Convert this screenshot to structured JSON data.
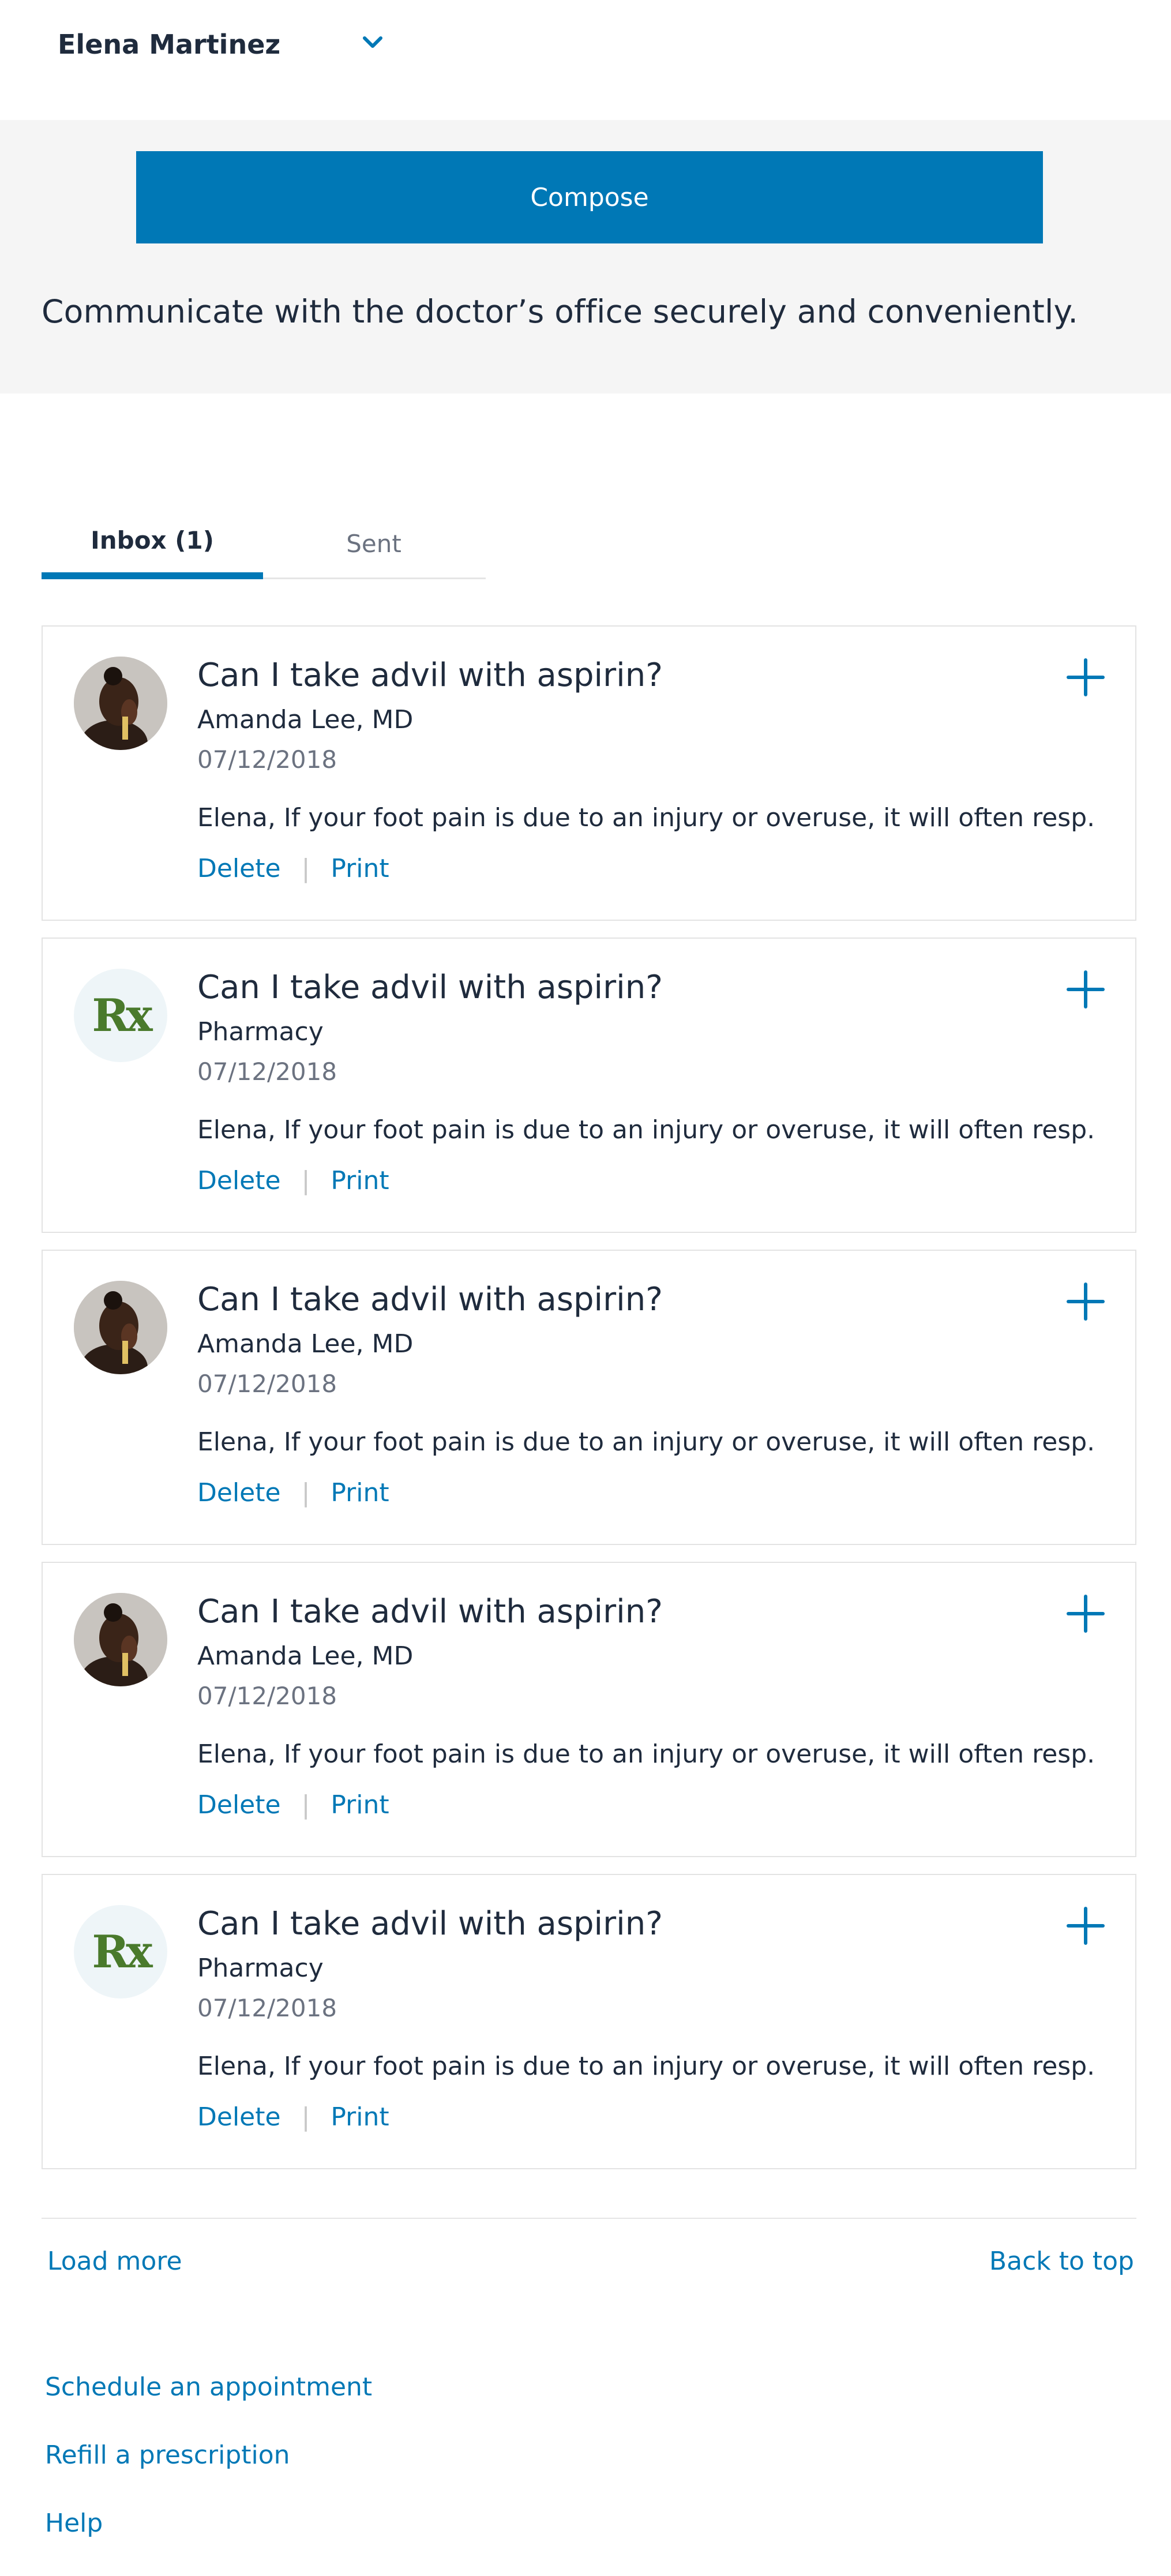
{
  "user": {
    "name": "Elena Martinez",
    "chevron_icon": "chevron-down-icon"
  },
  "hero": {
    "compose_label": "Compose",
    "description": "Communicate with the doctor’s office securely and conveniently."
  },
  "tabs": [
    {
      "label": "Inbox (1)",
      "active": true
    },
    {
      "label": "Sent",
      "active": false
    }
  ],
  "messages": [
    {
      "title": "Can I take advil with aspirin?",
      "sender": "Amanda Lee, MD",
      "date": "07/12/2018",
      "preview": "Elena, If your foot pain is due to an injury or overuse, it will often resp...",
      "avatar": "doctor-photo",
      "delete_label": "Delete",
      "print_label": "Print"
    },
    {
      "title": "Can I take advil with aspirin?",
      "sender": "Pharmacy",
      "date": "07/12/2018",
      "preview": "Elena, If your foot pain is due to an injury or overuse, it will often resp...",
      "avatar": "rx",
      "avatar_text": "Rx",
      "delete_label": "Delete",
      "print_label": "Print"
    },
    {
      "title": "Can I take advil with aspirin?",
      "sender": "Amanda Lee, MD",
      "date": "07/12/2018",
      "preview": "Elena, If your foot pain is due to an injury or overuse, it will often resp...",
      "avatar": "doctor-photo",
      "delete_label": "Delete",
      "print_label": "Print"
    },
    {
      "title": "Can I take advil with aspirin?",
      "sender": "Amanda Lee, MD",
      "date": "07/12/2018",
      "preview": "Elena, If your foot pain is due to an injury or overuse, it will often resp...",
      "avatar": "doctor-photo",
      "delete_label": "Delete",
      "print_label": "Print"
    },
    {
      "title": "Can I take advil with aspirin?",
      "sender": "Pharmacy",
      "date": "07/12/2018",
      "preview": "Elena, If your foot pain is due to an injury or overuse, it will often resp...",
      "avatar": "rx",
      "avatar_text": "Rx",
      "delete_label": "Delete",
      "print_label": "Print"
    }
  ],
  "pagination": {
    "load_more": "Load more",
    "back_to_top": "Back to top"
  },
  "footer_links": [
    {
      "label": "Schedule an appointment"
    },
    {
      "label": "Refill a prescription"
    },
    {
      "label": "Help"
    }
  ],
  "colors": {
    "accent": "#0078b6",
    "hero_bg": "#f5f5f5",
    "rx_green": "#4a7a2c"
  }
}
